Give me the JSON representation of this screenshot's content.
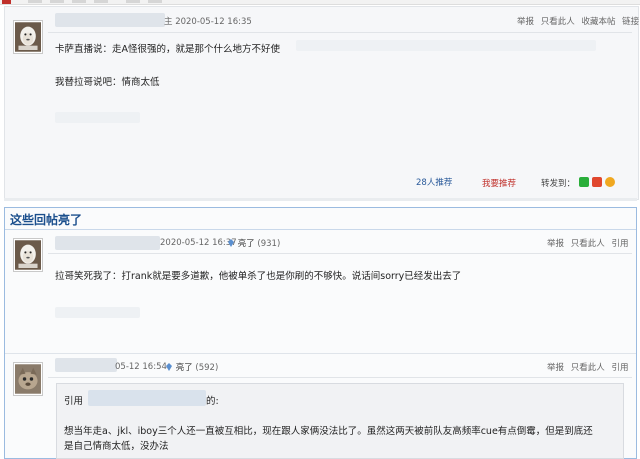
{
  "post1": {
    "time": "主 2020-05-12 16:35",
    "actions": [
      "举报",
      "只看此人",
      "收藏本帖",
      "链接"
    ],
    "line1": "卡萨直播说：走A怪很强的，就是那个什么地方不好使",
    "line2": "我替拉哥说吧：情商太低",
    "recommend": "28人推荐",
    "want_recommend": "我要推荐",
    "share_label": "转发到："
  },
  "section": {
    "title": "这些回帖亮了"
  },
  "reply1": {
    "time": "2020-05-12 16:37",
    "light": "亮了",
    "light_count": "(931)",
    "actions": [
      "举报",
      "只看此人",
      "引用"
    ],
    "text": "拉哥笑死我了：打rank就是要多道歉，他被单杀了也是你刷的不够快。说话间sorry已经发出去了"
  },
  "reply2": {
    "time": "05-12 16:54",
    "light": "亮了",
    "light_count": "(592)",
    "actions": [
      "举报",
      "只看此人",
      "引用"
    ],
    "quote_prefix": "引用",
    "quote_suffix": "的:",
    "quote_line1": "想当年走a、jkl、iboy三个人还一直被互相比，现在跟人家俩没法比了。虽然这两天被前队友高频率cue有点倒霉，但是到底还",
    "quote_line2": "是自己情商太低，没办法"
  },
  "colors": {
    "accent_blue": "#1b4f8d",
    "brand_red": "#c0302b",
    "border_blue": "#9bbbe0"
  }
}
